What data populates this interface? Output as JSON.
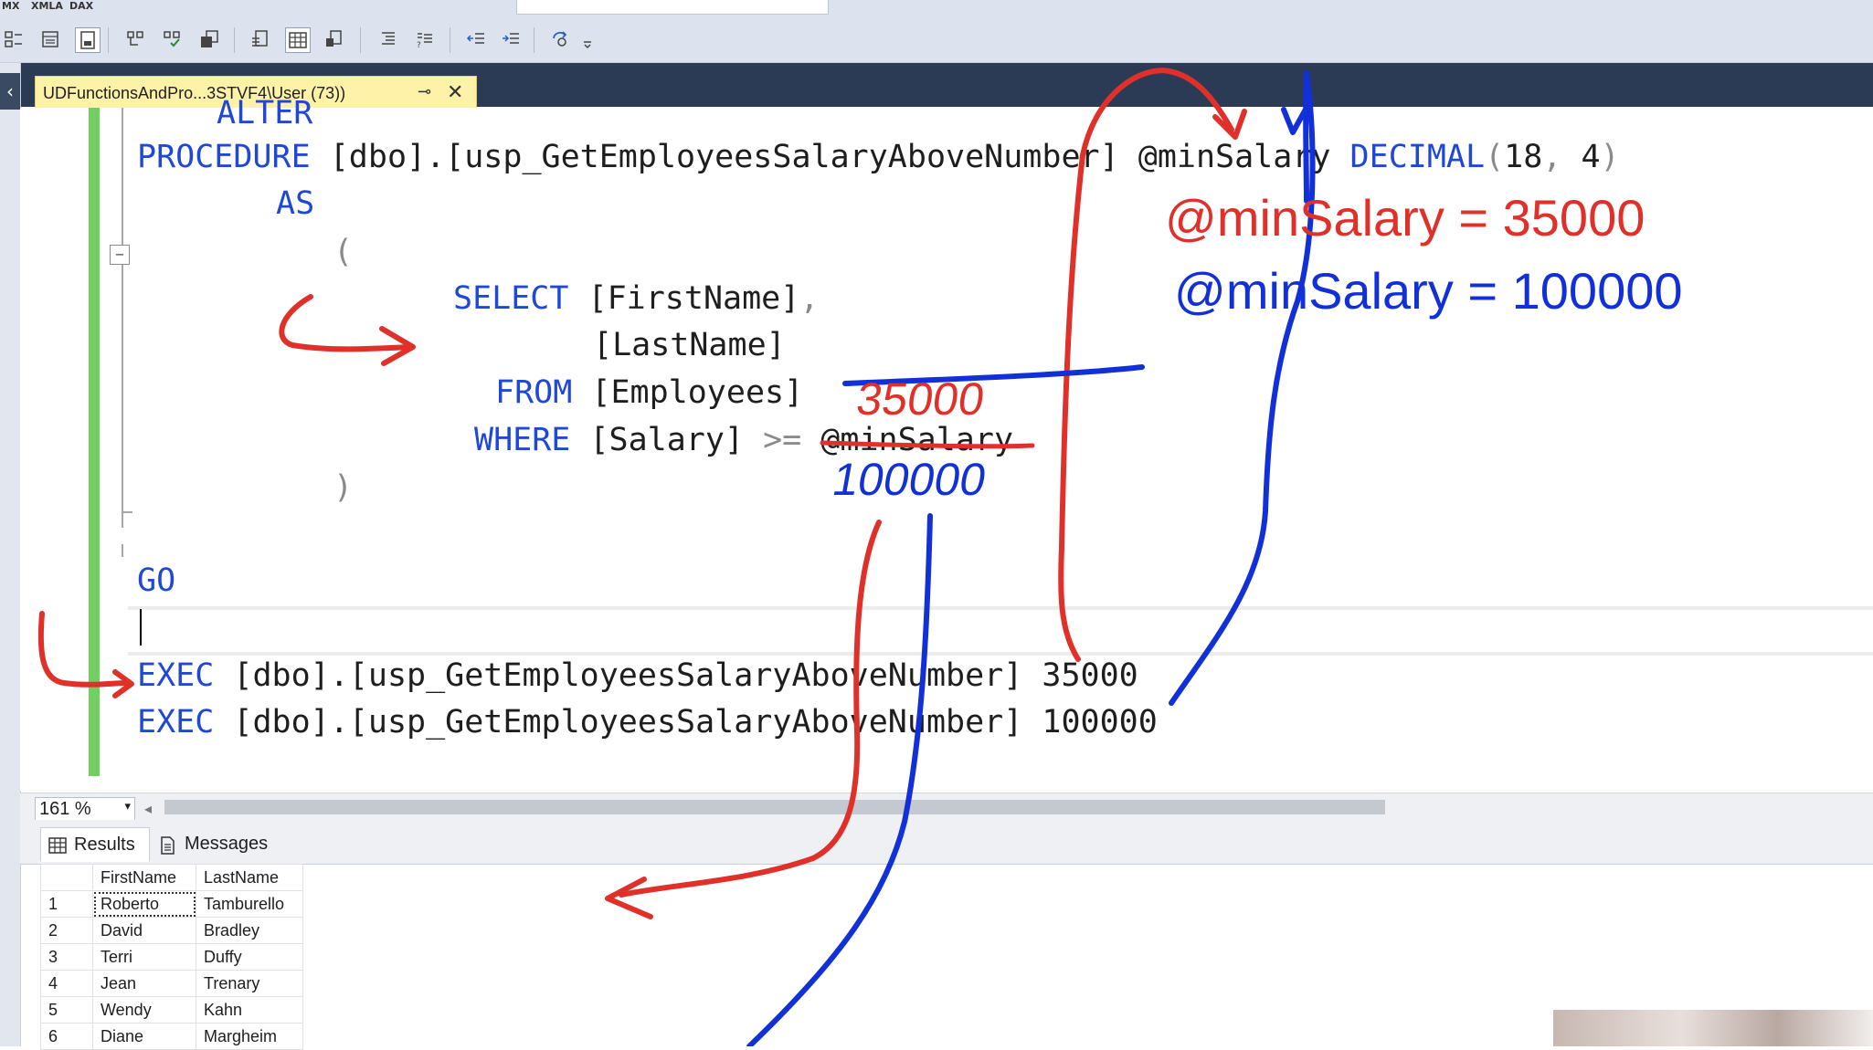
{
  "toolbar": {
    "top_labels": [
      "MX",
      "XMLA",
      "DAX"
    ],
    "icons": [
      "layout-icon",
      "window-icon",
      "pane-icon",
      "object-icon",
      "query-check-icon",
      "results-icon",
      "indent-icon",
      "table-icon",
      "swap-icon",
      "list-icon",
      "comment-icon",
      "outdent-icon",
      "indent-more-icon",
      "specify-values-icon",
      "dropdown-icon"
    ]
  },
  "document_tab": {
    "title": "UDFunctionsAndPro...3STVF4\\User (73))",
    "pin_icon": "⊸",
    "close_icon": "✕"
  },
  "editor": {
    "lines": {
      "alter": "ALTER",
      "procedure_kw": "PROCEDURE",
      "procedure_rest": " [dbo].[usp_GetEmployeesSalaryAboveNumber] @minSalary ",
      "decimal_kw": "DECIMAL",
      "decimal_open": "(",
      "decimal_args": "18",
      "decimal_comma": ",",
      "decimal_args2": " 4",
      "decimal_close": ")",
      "as_kw": "AS",
      "open_paren": "(",
      "select_kw": "SELECT",
      "select_col1": " [FirstName]",
      "select_comma": ",",
      "select_col2": "[LastName]",
      "from_kw": "FROM",
      "from_table": " [Employees]",
      "where_kw": "WHERE",
      "where_col": " [Salary] ",
      "where_op": ">=",
      "where_param": " @minSalary",
      "close_paren": ")",
      "go_kw": "GO",
      "exec1_kw": "EXEC",
      "exec1_rest": " [dbo].[usp_GetEmployeesSalaryAboveNumber] 35000",
      "exec2_kw": "EXEC",
      "exec2_rest": " [dbo].[usp_GetEmployeesSalaryAboveNumber] 100000"
    }
  },
  "statusbar": {
    "zoom": "161 %",
    "zoom_arrow": "▾",
    "scroll_left": "◂"
  },
  "results": {
    "tabs": [
      {
        "label": "Results",
        "icon": "grid-icon"
      },
      {
        "label": "Messages",
        "icon": "messages-icon"
      }
    ],
    "columns": [
      "FirstName",
      "LastName"
    ],
    "rows": [
      {
        "n": "1",
        "first": "Roberto",
        "last": "Tamburello"
      },
      {
        "n": "2",
        "first": "David",
        "last": "Bradley"
      },
      {
        "n": "3",
        "first": "Terri",
        "last": "Duffy"
      },
      {
        "n": "4",
        "first": "Jean",
        "last": "Trenary"
      },
      {
        "n": "5",
        "first": "Wendy",
        "last": "Kahn"
      },
      {
        "n": "6",
        "first": "Diane",
        "last": "Margheim"
      }
    ]
  },
  "annotations": {
    "red_text": "@minSalary = 35000",
    "blue_text": "@minSalary = 100000",
    "red_scribble": "35000",
    "blue_scribble": "100000",
    "red_color": "#e0302a",
    "blue_color": "#1230d8"
  }
}
